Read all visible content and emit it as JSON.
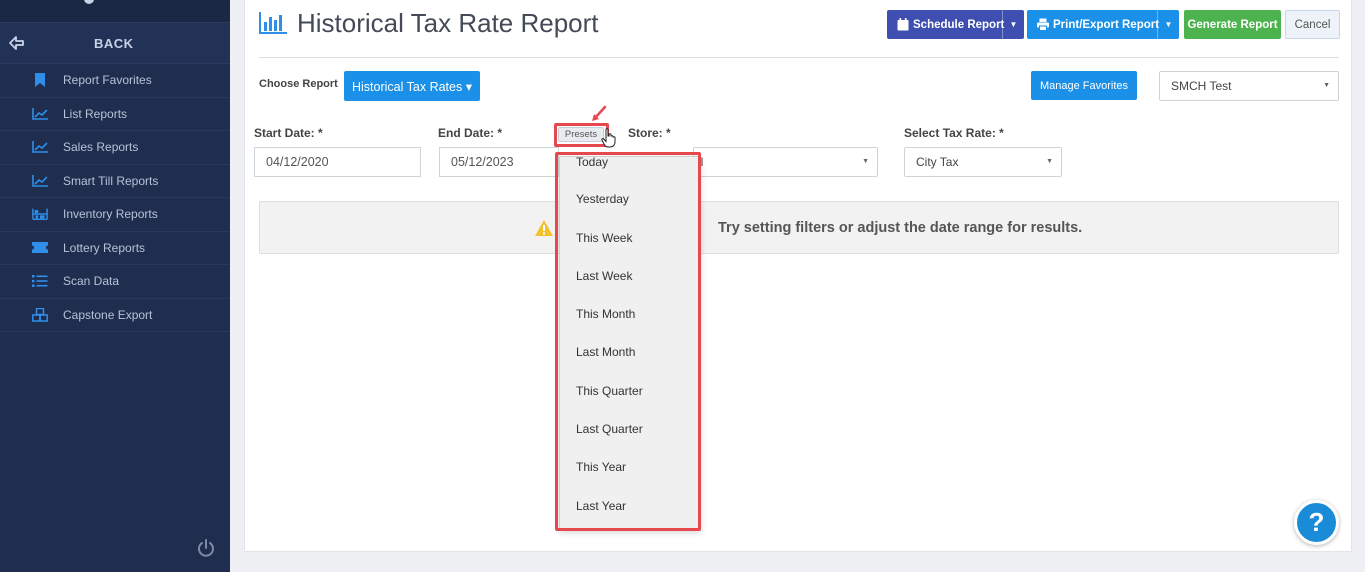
{
  "sidebar": {
    "back_label": "BACK",
    "items": [
      {
        "label": "Report Favorites",
        "icon": "bookmark-icon"
      },
      {
        "label": "List Reports",
        "icon": "line-chart-icon"
      },
      {
        "label": "Sales Reports",
        "icon": "line-chart-icon"
      },
      {
        "label": "Smart Till Reports",
        "icon": "line-chart-icon"
      },
      {
        "label": "Inventory Reports",
        "icon": "inventory-icon"
      },
      {
        "label": "Lottery Reports",
        "icon": "ticket-icon"
      },
      {
        "label": "Scan Data",
        "icon": "list-icon"
      },
      {
        "label": "Capstone Export",
        "icon": "boxes-icon"
      }
    ]
  },
  "header": {
    "title": "Historical Tax Rate Report",
    "schedule_label": "Schedule Report",
    "print_label": "Print/Export Report",
    "generate_label": "Generate Report",
    "cancel_label": "Cancel"
  },
  "controls": {
    "choose_label": "Choose Report",
    "report_button": "Historical Tax Rates ▾",
    "manage_favorites": "Manage Favorites",
    "store_select": "SMCH Test"
  },
  "filters": {
    "start_label": "Start Date: *",
    "start_value": "04/12/2020",
    "end_label": "End Date: *",
    "end_value": "05/12/2023",
    "presets_label": "Presets",
    "store_label": "Store: *",
    "store_value": "ll",
    "tax_label": "Select Tax Rate: *",
    "tax_value": "City Tax"
  },
  "alert": {
    "text": "Try setting filters or adjust the date range for results."
  },
  "presets": [
    "Today",
    "Yesterday",
    "This Week",
    "Last Week",
    "This Month",
    "Last Month",
    "This Quarter",
    "Last Quarter",
    "This Year",
    "Last Year"
  ],
  "help_label": "?",
  "colors": {
    "sidebar": "#1f2d4e",
    "primary": "#1a90e8",
    "schedule": "#3f4fb1",
    "generate": "#4cb34f",
    "highlight": "#e5484d"
  }
}
